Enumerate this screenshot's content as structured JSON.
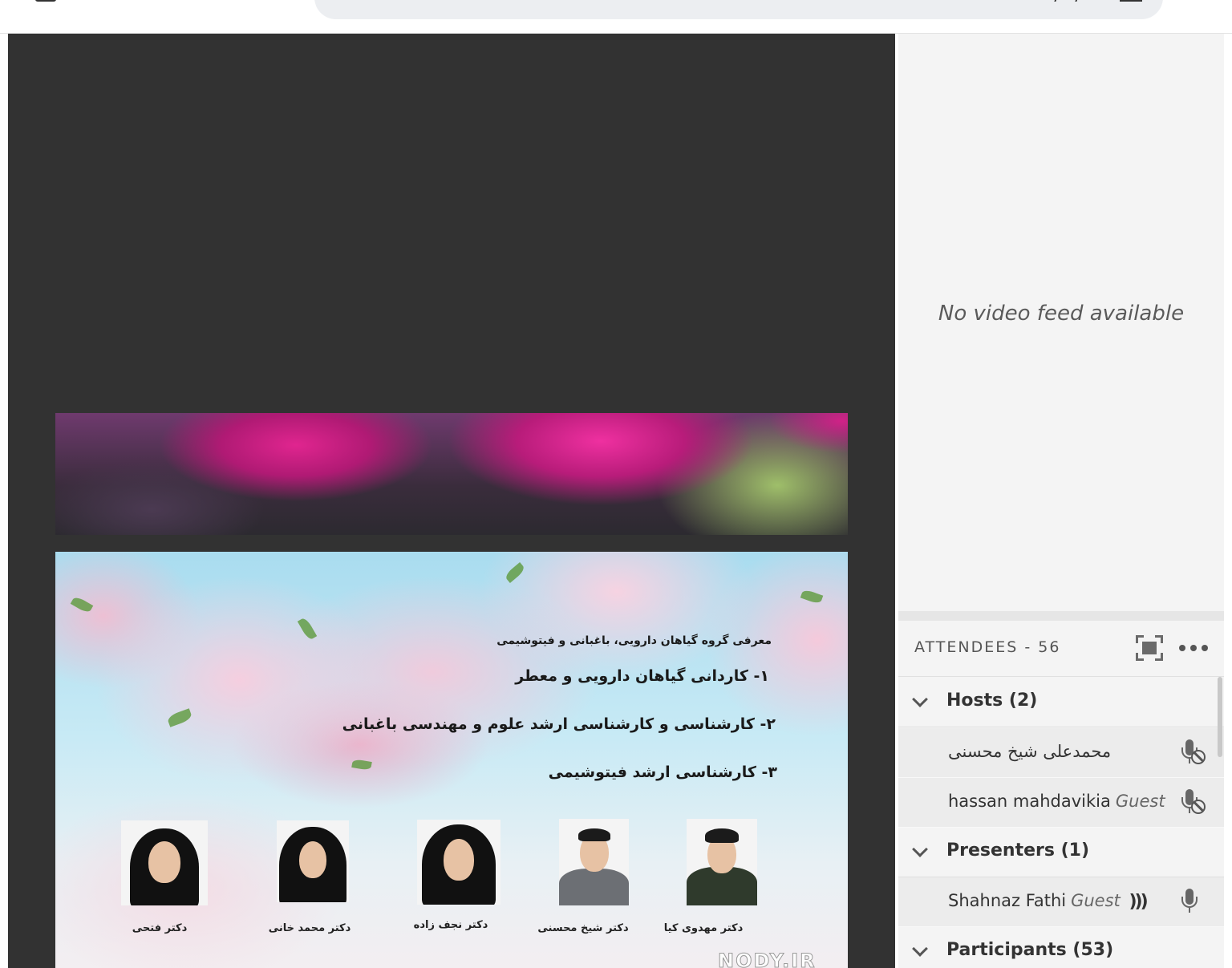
{
  "slide": {
    "heading": "معرفی گروه گیاهان دارویی، باغبانی و فیتوشیمی",
    "items": [
      "۱- کاردانی گیاهان دارویی و معطر",
      "۲- کارشناسی و کارشناسی ارشد علوم و مهندسی باغبانی",
      "۳- کارشناسی ارشد فیتوشیمی"
    ],
    "faculty": [
      "دکتر فتحی",
      "دکتر محمد خانی",
      "دکتر نجف زاده",
      "دکتر شیخ محسنی",
      "دکتر مهدوی کیا"
    ],
    "watermark": "NODY.IR"
  },
  "video": {
    "message": "No video feed available"
  },
  "attendees": {
    "title": "ATTENDEES  - 56",
    "groups": {
      "hosts": {
        "label": "Hosts (2)",
        "members": [
          {
            "name": "محمدعلی شیخ محسنی",
            "role": ""
          },
          {
            "name": "hassan mahdavikia",
            "role": "Guest"
          }
        ]
      },
      "presenters": {
        "label": "Presenters (1)",
        "members": [
          {
            "name": "Shahnaz Fathi",
            "role": "Guest"
          }
        ]
      },
      "participants": {
        "label": "Participants (53)"
      }
    }
  },
  "icons": {
    "fullscreen": "fullscreen-icon",
    "more": "more-options-icon",
    "mic_muted": "mic-muted-icon",
    "mic": "mic-icon",
    "speaking": "speaking-indicator-icon",
    "chevron": "chevron-down-icon"
  }
}
